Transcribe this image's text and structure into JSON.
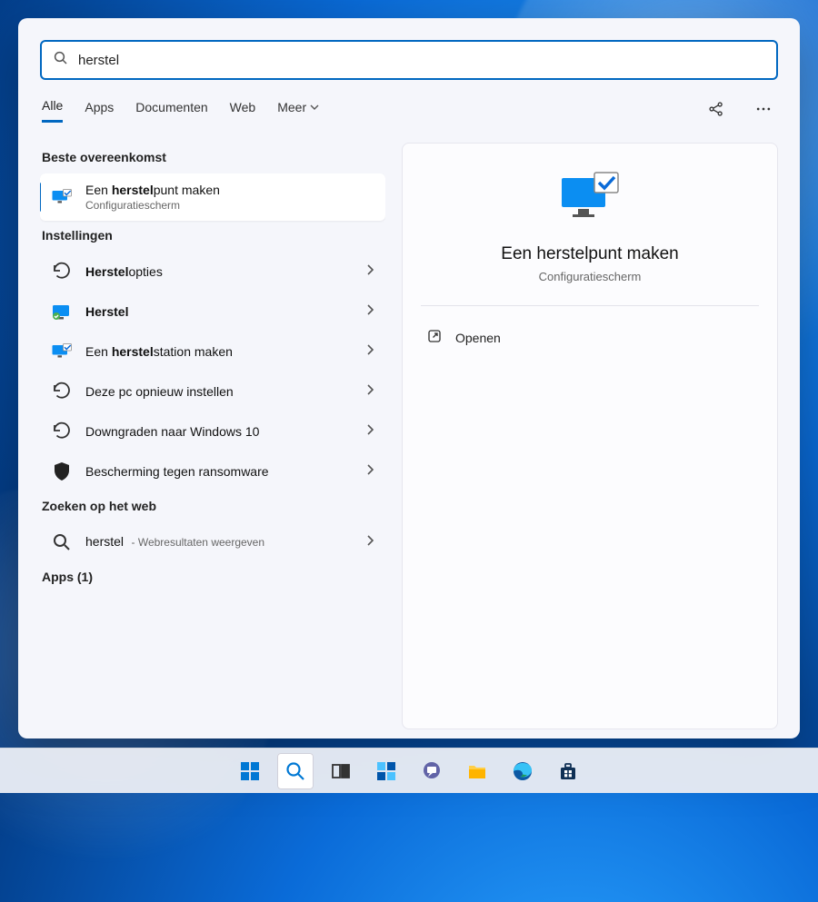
{
  "search": {
    "query": "herstel"
  },
  "filters": {
    "tabs": [
      "Alle",
      "Apps",
      "Documenten",
      "Web"
    ],
    "more_label": "Meer",
    "active_index": 0
  },
  "sections": {
    "best_match": "Beste overeenkomst",
    "settings": "Instellingen",
    "web_search": "Zoeken op het web",
    "apps_count": "Apps (1)"
  },
  "best_match": {
    "prefix": "Een ",
    "highlight": "herstel",
    "suffix": "punt maken",
    "subtitle": "Configuratiescherm"
  },
  "settings_items": [
    {
      "prefix": "",
      "highlight": "Herstel",
      "suffix": "opties",
      "icon": "restore"
    },
    {
      "prefix": "",
      "highlight": "Herstel",
      "suffix": "",
      "icon": "recovery"
    },
    {
      "prefix": "Een ",
      "highlight": "herstel",
      "suffix": "station maken",
      "icon": "monitor"
    },
    {
      "prefix": "Deze pc opnieuw instellen",
      "highlight": "",
      "suffix": "",
      "icon": "restore"
    },
    {
      "prefix": "Downgraden naar Windows 10",
      "highlight": "",
      "suffix": "",
      "icon": "restore"
    },
    {
      "prefix": "Bescherming tegen ransomware",
      "highlight": "",
      "suffix": "",
      "icon": "shield"
    }
  ],
  "web_item": {
    "query": "herstel",
    "hint": "Webresultaten weergeven"
  },
  "preview": {
    "title": "Een herstelpunt maken",
    "subtitle": "Configuratiescherm",
    "open_label": "Openen"
  }
}
